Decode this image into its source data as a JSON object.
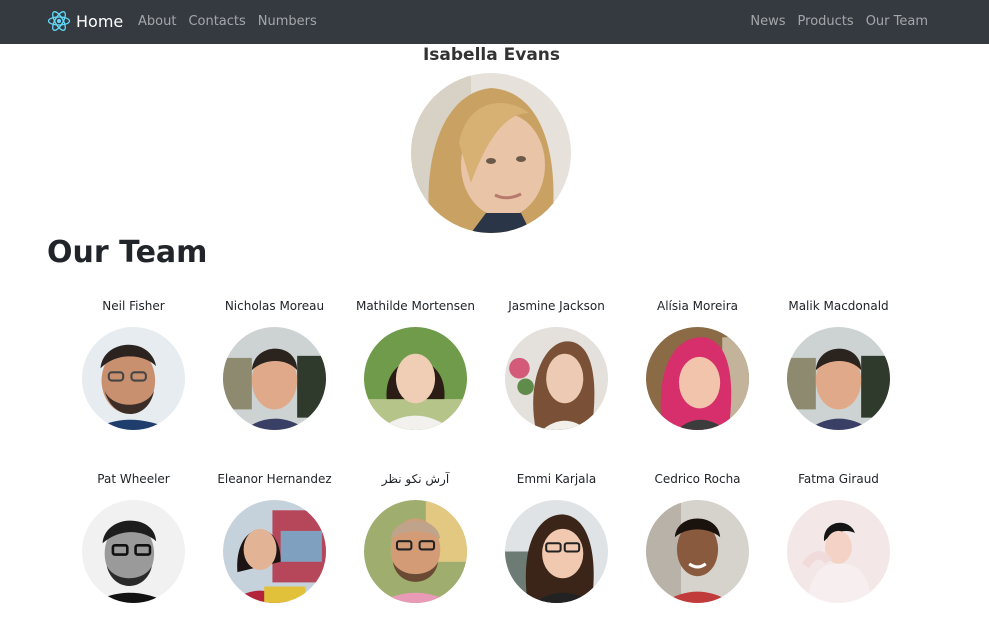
{
  "navbar": {
    "brand": "Home",
    "left_links": [
      "About",
      "Contacts",
      "Numbers"
    ],
    "right_links": [
      "News",
      "Products",
      "Our Team"
    ]
  },
  "featured": {
    "name": "Isabella Evans"
  },
  "team": {
    "title": "Our Team",
    "members": [
      {
        "name": "Neil Fisher"
      },
      {
        "name": "Nicholas Moreau"
      },
      {
        "name": "Mathilde Mortensen"
      },
      {
        "name": "Jasmine Jackson"
      },
      {
        "name": "Alísia Moreira"
      },
      {
        "name": "Malik Macdonald"
      },
      {
        "name": "Pat Wheeler"
      },
      {
        "name": "Eleanor Hernandez"
      },
      {
        "name": "آرش نکو نظر"
      },
      {
        "name": "Emmi Karjala"
      },
      {
        "name": "Cedrico Rocha"
      },
      {
        "name": "Fatma Giraud"
      }
    ]
  }
}
